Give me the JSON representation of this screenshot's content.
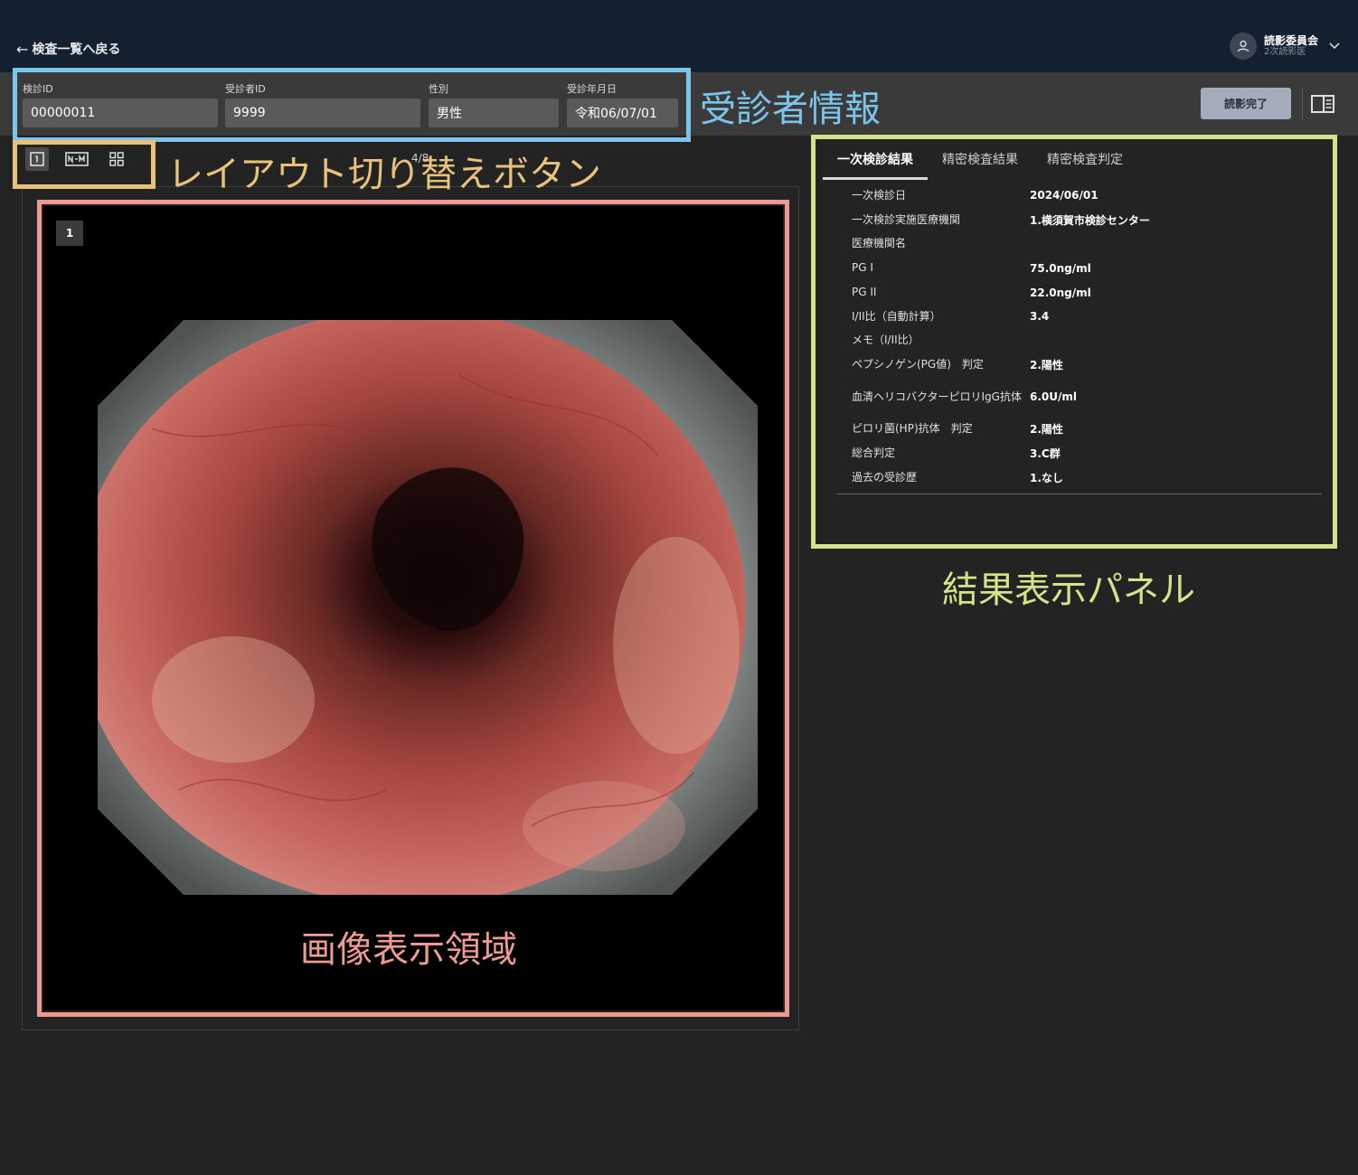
{
  "header": {
    "back_label": "検査一覧へ戻る",
    "user_name": "読影委員会",
    "user_role": "2次読影医"
  },
  "patient": {
    "fields": [
      {
        "label": "検診ID",
        "value": "00000011"
      },
      {
        "label": "受診者ID",
        "value": "9999"
      },
      {
        "label": "性別",
        "value": "男性"
      },
      {
        "label": "受診年月日",
        "value": "令和06/07/01"
      }
    ],
    "complete_button": "読影完了"
  },
  "viewer": {
    "image_count": "4/8",
    "image_index": "1",
    "layout_buttons": [
      "single-layout",
      "n-by-m-layout",
      "grid-layout"
    ]
  },
  "results": {
    "tabs": [
      "一次検診結果",
      "精密検査結果",
      "精密検査判定"
    ],
    "active_tab": 0,
    "rows": [
      {
        "label": "一次検診日",
        "value": "2024/06/01"
      },
      {
        "label": "一次検診実施医療機関",
        "value": "1.横須賀市検診センター"
      },
      {
        "label": "医療機関名",
        "value": ""
      },
      {
        "label": "PG I",
        "value": "75.0ng/ml"
      },
      {
        "label": "PG II",
        "value": "22.0ng/ml"
      },
      {
        "label": "I/II比（自動計算）",
        "value": "3.4"
      },
      {
        "label": "メモ（I/II比）",
        "value": ""
      },
      {
        "label": "ペプシノゲン(PG値)　判定",
        "value": "2.陽性"
      },
      {
        "label": "血清ヘリコバクターピロリIgG抗体",
        "value": "6.0U/ml"
      },
      {
        "label": "ピロリ菌(HP)抗体　判定",
        "value": "2.陽性"
      },
      {
        "label": "総合判定",
        "value": "3.C群"
      },
      {
        "label": "過去の受診歴",
        "value": "1.なし"
      }
    ]
  },
  "annotations": [
    {
      "label": "受診者情報",
      "color": "#7cc4ea"
    },
    {
      "label": "レイアウト切り替えボタン",
      "color": "#e8c27a"
    },
    {
      "label": "画像表示領域",
      "color": "#ee9a92"
    },
    {
      "label": "結果表示パネル",
      "color": "#d4e28a"
    }
  ],
  "colors": {
    "topbar": "#13202f",
    "background": "#232323",
    "patient_bar": "#3a3a3a",
    "complete_button": "#a6abba"
  }
}
